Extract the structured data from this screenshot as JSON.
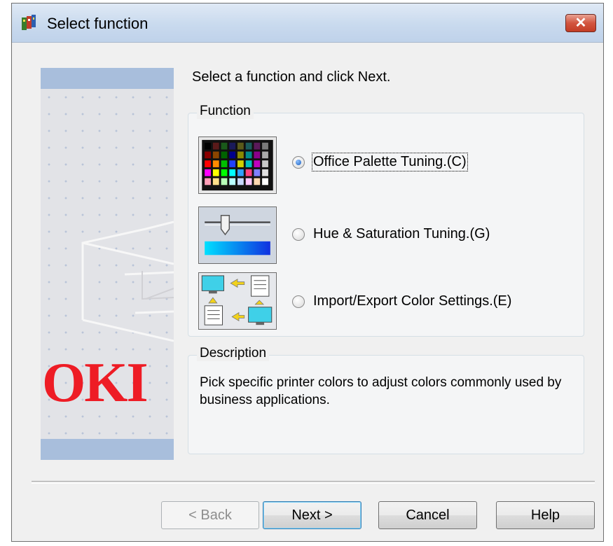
{
  "window": {
    "title": "Select function",
    "close_label": "✕"
  },
  "banner": {
    "logo_text": "OKI"
  },
  "instruction": "Select a function and click Next.",
  "function_group": {
    "label": "Function",
    "options": [
      {
        "label": "Office Palette Tuning.(C)",
        "checked": true,
        "icon": "color-palette-icon"
      },
      {
        "label": "Hue & Saturation Tuning.(G)",
        "checked": false,
        "icon": "hue-saturation-slider-icon"
      },
      {
        "label": "Import/Export Color Settings.(E)",
        "checked": false,
        "icon": "import-export-icon"
      }
    ]
  },
  "description_group": {
    "label": "Description",
    "text": "Pick specific printer colors to adjust colors commonly used by business applications."
  },
  "buttons": {
    "back": "< Back",
    "next": "Next >",
    "cancel": "Cancel",
    "help": "Help"
  },
  "colors": {
    "title_bar": "#c9daee",
    "close_button": "#d2553f",
    "banner_strip": "#a8bedc",
    "logo": "#ee1c25",
    "radio_selected": "#1a5fbf"
  }
}
